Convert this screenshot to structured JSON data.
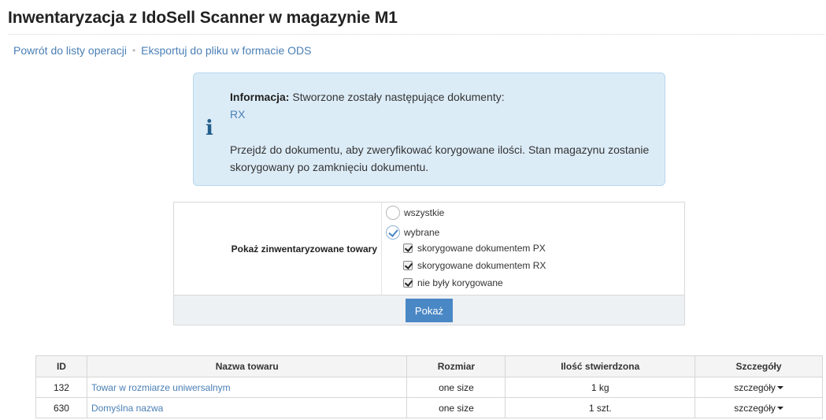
{
  "page": {
    "title": "Inwentaryzacja z IdoSell Scanner w magazynie M1"
  },
  "breadcrumb": {
    "back_label": "Powrót do listy operacji",
    "separator": "•",
    "export_label": "Eksportuj do pliku w formacie ODS"
  },
  "info": {
    "icon": "info-icon",
    "heading": "Informacja:",
    "intro": " Stworzone zostały następujące dokumenty:",
    "document_link": "RX",
    "message": "Przejdź do dokumentu, aby zweryfikować korygowane ilości. Stan magazynu zostanie skorygowany po zamknięciu dokumentu."
  },
  "filter": {
    "label": "Pokaż zinwentaryzowane towary",
    "radio_all": "wszystkie",
    "radio_selected": "wybrane",
    "selected_radio": "wybrane",
    "checkboxes": [
      {
        "label": "skorygowane dokumentem PX",
        "checked": true
      },
      {
        "label": "skorygowane dokumentem RX",
        "checked": true
      },
      {
        "label": "nie były korygowane",
        "checked": true
      }
    ],
    "submit_label": "Pokaż"
  },
  "table": {
    "headers": [
      "ID",
      "Nazwa towaru",
      "Rozmiar",
      "Ilość stwierdzona",
      "Szczegóły"
    ],
    "rows": [
      {
        "id": "132",
        "name": "Towar w rozmiarze uniwersalnym",
        "size": "one size",
        "qty": "1 kg",
        "details": "szczegóły"
      },
      {
        "id": "630",
        "name": "Domyślna nazwa",
        "size": "one size",
        "qty": "1 szt.",
        "details": "szczegóły"
      }
    ]
  },
  "colors": {
    "link": "#4a7fb5",
    "info_bg": "#dcecf7",
    "info_icon": "#245f8c",
    "button": "#4a87c5"
  }
}
